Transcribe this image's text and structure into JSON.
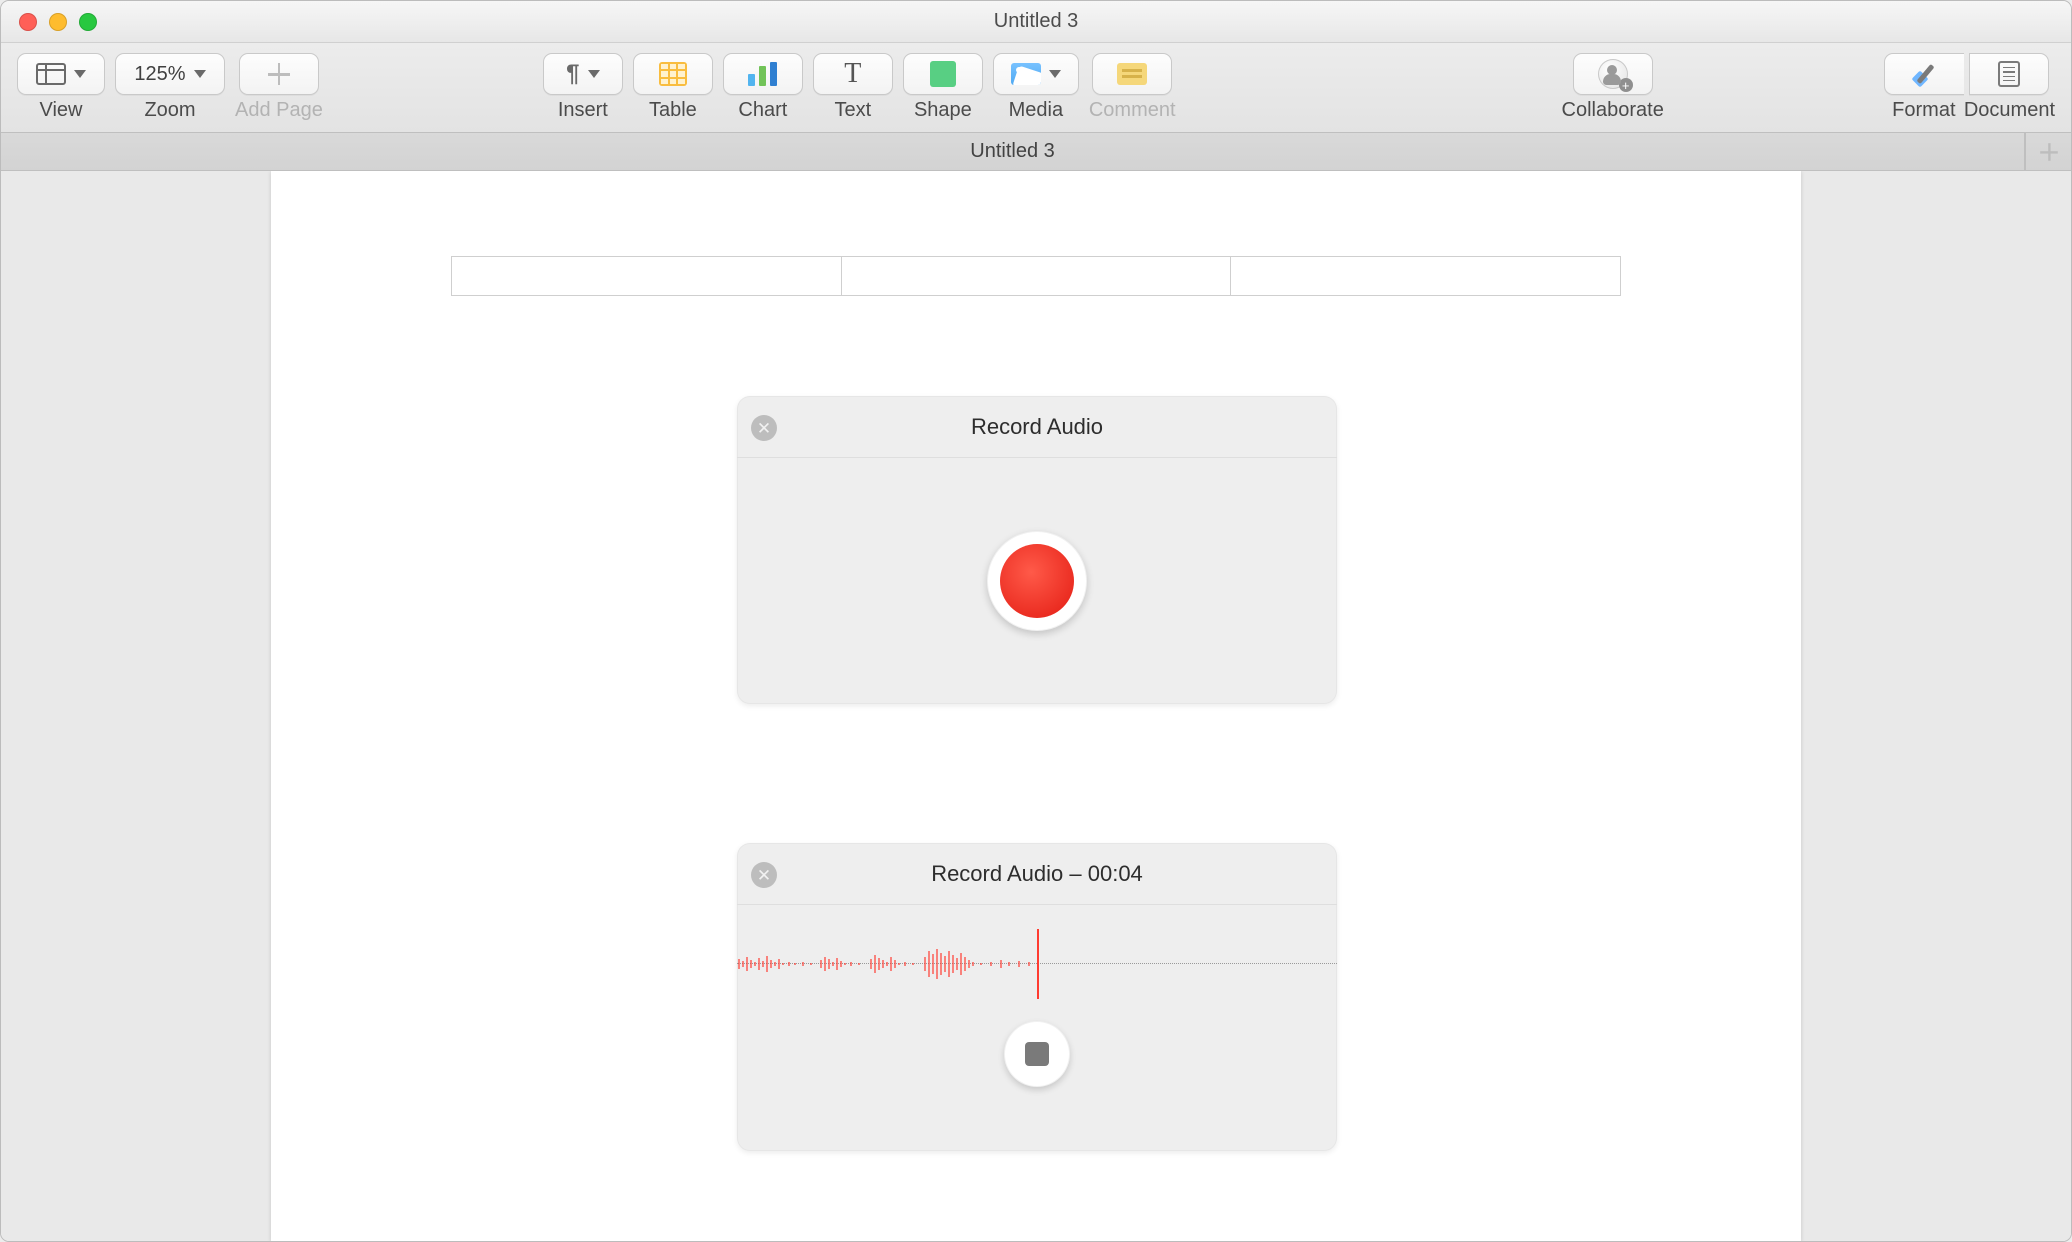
{
  "window": {
    "title": "Untitled 3"
  },
  "toolbar": {
    "view": "View",
    "zoom_value": "125%",
    "zoom": "Zoom",
    "add_page": "Add Page",
    "insert": "Insert",
    "table": "Table",
    "chart": "Chart",
    "text": "Text",
    "shape": "Shape",
    "media": "Media",
    "comment": "Comment",
    "collaborate": "Collaborate",
    "format": "Format",
    "document": "Document"
  },
  "tabbar": {
    "doc_tab": "Untitled 3"
  },
  "panels": {
    "record_idle": {
      "title": "Record Audio"
    },
    "record_active": {
      "title": "Record Audio – 00:04"
    }
  }
}
